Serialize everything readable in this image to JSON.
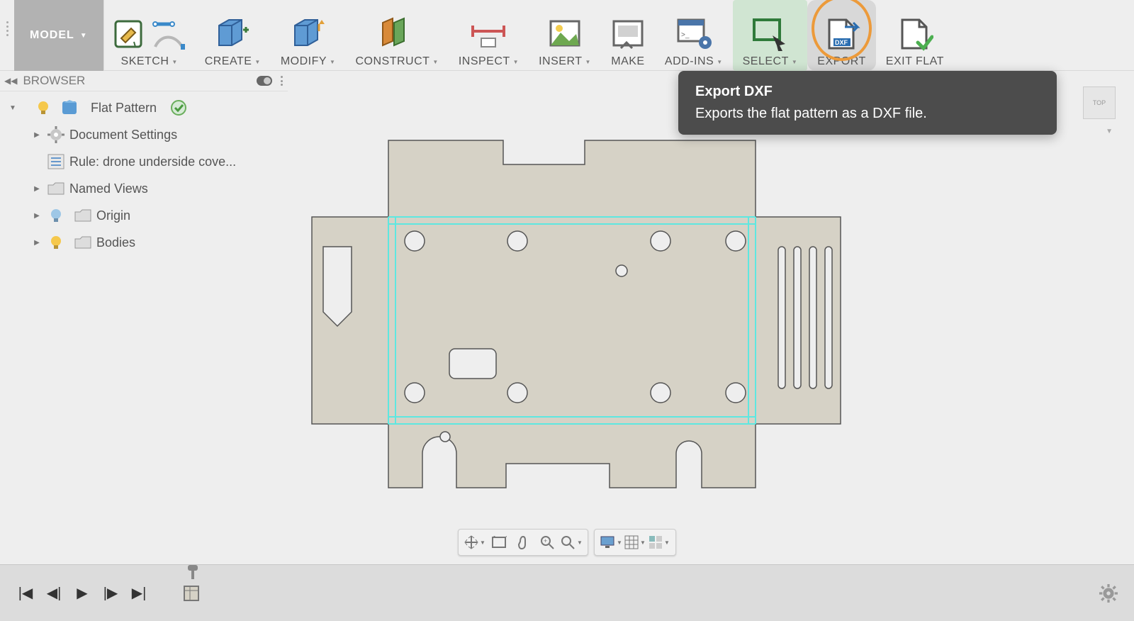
{
  "workspace": {
    "label": "MODEL"
  },
  "toolbar": {
    "items": [
      {
        "label": "SKETCH",
        "caret": true
      },
      {
        "label": "CREATE",
        "caret": true
      },
      {
        "label": "MODIFY",
        "caret": true
      },
      {
        "label": "CONSTRUCT",
        "caret": true
      },
      {
        "label": "INSPECT",
        "caret": true
      },
      {
        "label": "INSERT",
        "caret": true
      },
      {
        "label": "MAKE",
        "caret": false
      },
      {
        "label": "ADD-INS",
        "caret": true
      },
      {
        "label": "SELECT",
        "caret": true
      },
      {
        "label": "EXPORT",
        "caret": false
      },
      {
        "label": "EXIT FLAT",
        "caret": false
      }
    ]
  },
  "tooltip": {
    "title": "Export DXF",
    "body": "Exports the flat pattern as a DXF file."
  },
  "browser": {
    "header": "BROWSER",
    "tree": {
      "root": "Flat Pattern",
      "doc_settings": "Document Settings",
      "rule": "Rule: drone underside cove...",
      "named_views": "Named Views",
      "origin": "Origin",
      "bodies": "Bodies"
    }
  },
  "viewcube": {
    "label": "TOP"
  }
}
